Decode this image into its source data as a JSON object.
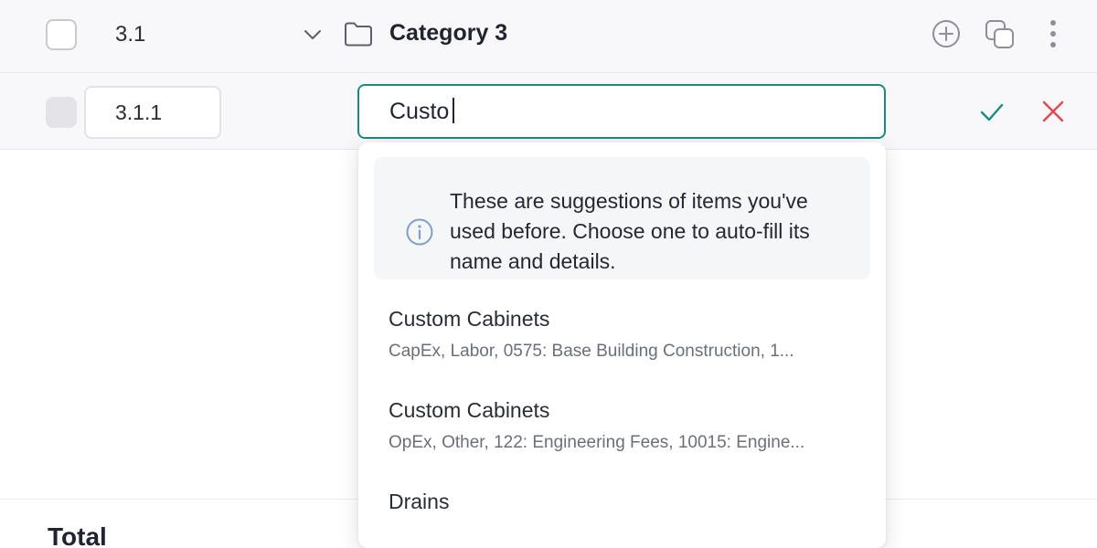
{
  "category_row": {
    "code": "3.1",
    "name": "Category 3"
  },
  "edit_row": {
    "code_value": "3.1.1",
    "name_value": "Custo"
  },
  "suggestions_dropdown": {
    "info_text": "These are suggestions of items you've used before. Choose one to auto-fill its name and details.",
    "items": [
      {
        "title": "Custom Cabinets",
        "detail": "CapEx, Labor, 0575: Base Building Construction, 1..."
      },
      {
        "title": "Custom Cabinets",
        "detail": "OpEx, Other, 122: Engineering Fees, 10015: Engine..."
      },
      {
        "title": "Drains",
        "detail": ""
      }
    ]
  },
  "footer": {
    "total_label": "Total"
  },
  "colors": {
    "accent": "#1a8a82",
    "cancel": "#e0484e",
    "icon_gray": "#8e9099"
  },
  "icons": [
    "chevron-down-icon",
    "folder-icon",
    "add-circle-icon",
    "duplicate-icon",
    "more-vertical-icon",
    "check-icon",
    "close-icon",
    "info-icon"
  ]
}
